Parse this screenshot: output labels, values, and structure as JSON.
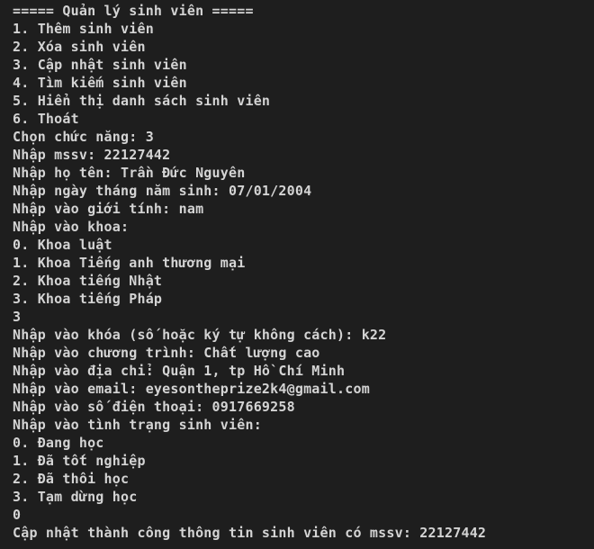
{
  "terminal": {
    "lines": [
      "===== Quản lý sinh viên =====",
      "1. Thêm sinh viên",
      "2. Xóa sinh viên",
      "3. Cập nhật sinh viên",
      "4. Tìm kiếm sinh viên",
      "5. Hiển thị danh sách sinh viên",
      "6. Thoát",
      "Chọn chức năng: 3",
      "Nhập mssv: 22127442",
      "Nhập họ tên: Trần Đức Nguyên",
      "Nhập ngày tháng năm sinh: 07/01/2004",
      "Nhập vào giới tính: nam",
      "Nhập vào khoa:",
      "0. Khoa luật",
      "1. Khoa Tiếng anh thương mại",
      "2. Khoa tiếng Nhật",
      "3. Khoa tiếng Pháp",
      "3",
      "Nhập vào khóa (số hoặc ký tự không cách): k22",
      "Nhập vào chương trình: Chất lượng cao",
      "Nhập vào địa chỉ: Quận 1, tp Hồ Chí Minh",
      "Nhập vào email: eyesontheprize2k4@gmail.com",
      "Nhập vào số điện thoại: 0917669258",
      "Nhập vào tình trạng sinh viên:",
      "0. Đang học",
      "1. Đã tốt nghiệp",
      "2. Đã thôi học",
      "3. Tạm dừng học",
      "0",
      "Cập nhật thành công thông tin sinh viên có mssv: 22127442"
    ]
  },
  "colors": {
    "background": "#1e1e1e",
    "text": "#d4d4d4"
  }
}
